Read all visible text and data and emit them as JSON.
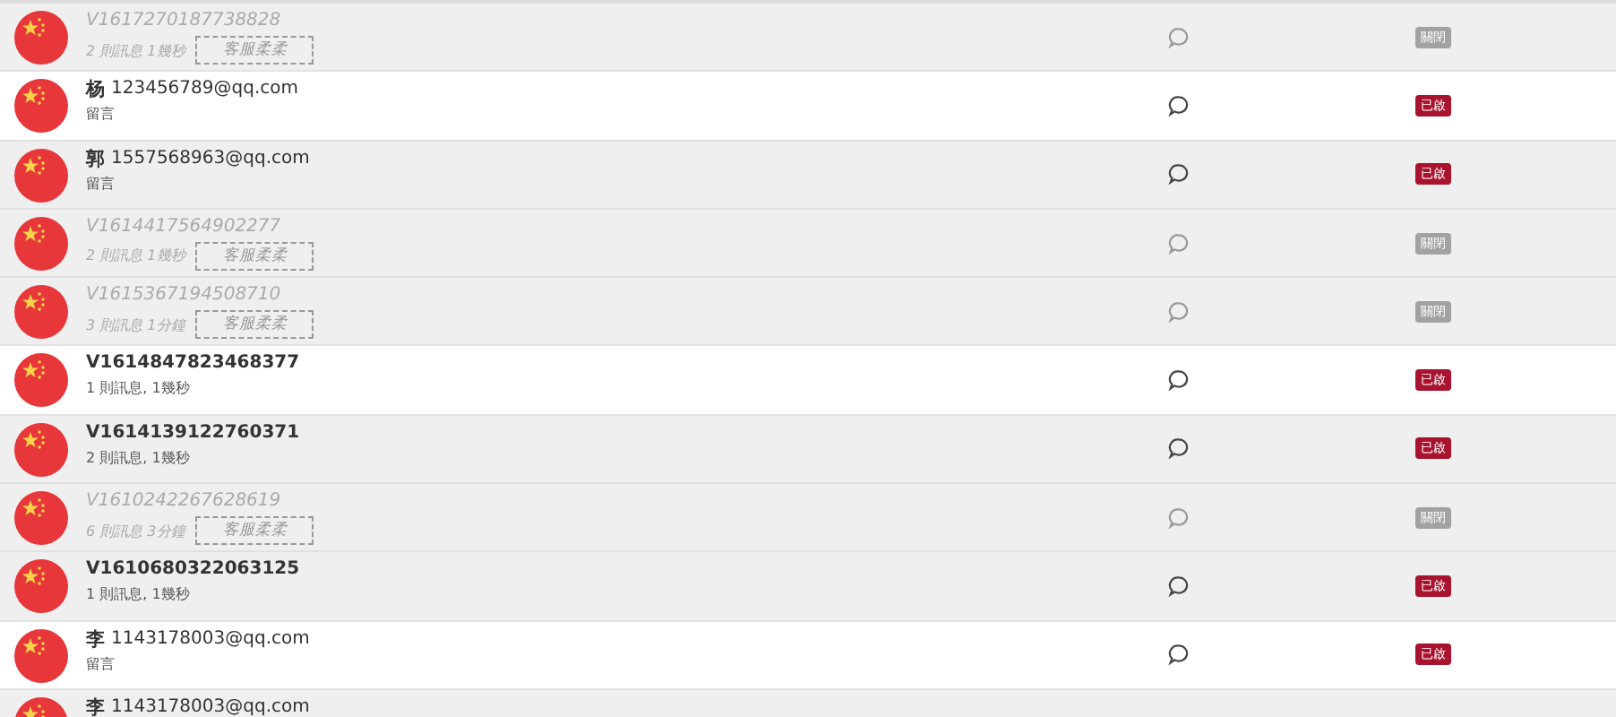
{
  "conversations": [
    {
      "kind": "visitor",
      "title": "V1617270187738828",
      "summary": "2 則訊息 1幾秒",
      "agent": "客服柔柔",
      "inactive": true,
      "status": {
        "on": false,
        "label": "關閉"
      }
    },
    {
      "kind": "guest",
      "surname": "杨",
      "title": "123456789@qq.com",
      "summary": "留言",
      "inactive": false,
      "status": {
        "on": true,
        "label": "已啟"
      }
    },
    {
      "kind": "guest",
      "surname": "郭",
      "title": "1557568963@qq.com",
      "summary": "留言",
      "inactive": false,
      "status": {
        "on": true,
        "label": "已啟"
      }
    },
    {
      "kind": "visitor",
      "title": "V1614417564902277",
      "summary": "2 則訊息 1幾秒",
      "agent": "客服柔柔",
      "inactive": true,
      "status": {
        "on": false,
        "label": "關閉"
      }
    },
    {
      "kind": "visitor",
      "title": "V1615367194508710",
      "summary": "3 則訊息 1分鐘",
      "agent": "客服柔柔",
      "inactive": true,
      "status": {
        "on": false,
        "label": "關閉"
      }
    },
    {
      "kind": "visitor",
      "title": "V1614847823468377",
      "summary": "1 則訊息, 1幾秒",
      "inactive": false,
      "status": {
        "on": true,
        "label": "已啟"
      }
    },
    {
      "kind": "visitor",
      "title": "V1614139122760371",
      "summary": "2 則訊息, 1幾秒",
      "inactive": false,
      "status": {
        "on": true,
        "label": "已啟"
      }
    },
    {
      "kind": "visitor",
      "title": "V1610242267628619",
      "summary": "6 則訊息 3分鐘",
      "agent": "客服柔柔",
      "inactive": true,
      "status": {
        "on": false,
        "label": "關閉"
      }
    },
    {
      "kind": "visitor",
      "title": "V1610680322063125",
      "summary": "1 則訊息, 1幾秒",
      "inactive": false,
      "status": {
        "on": true,
        "label": "已啟"
      }
    },
    {
      "kind": "guest",
      "surname": "李",
      "title": "1143178003@qq.com",
      "summary": "留言",
      "inactive": false,
      "status": {
        "on": true,
        "label": "已啟"
      }
    },
    {
      "kind": "guest",
      "surname": "李",
      "title": "1143178003@qq.com",
      "inactive": false
    }
  ]
}
